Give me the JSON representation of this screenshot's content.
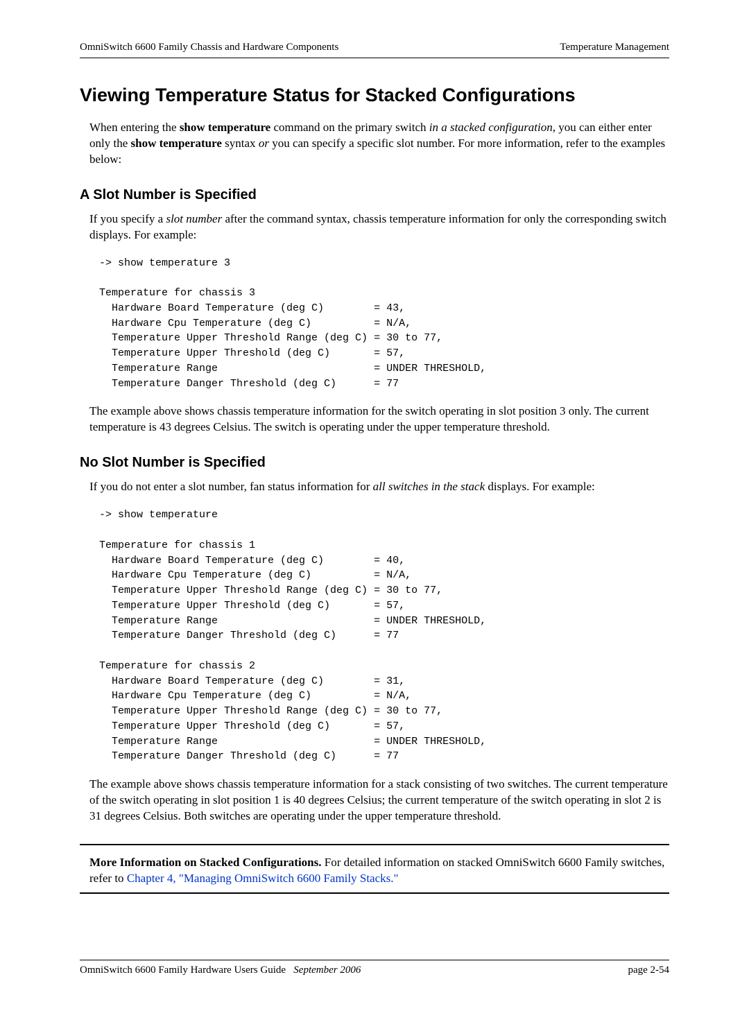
{
  "header": {
    "left": "OmniSwitch 6600 Family Chassis and Hardware Components",
    "right": "Temperature Management"
  },
  "h1": "Viewing Temperature Status for Stacked Configurations",
  "intro": {
    "part1": "When entering the ",
    "cmd": "show temperature",
    "part2": " command on the primary switch ",
    "italic1": "in a stacked configuration",
    "part3": ", you can either enter only the ",
    "cmd2": "show temperature",
    "part4": " syntax ",
    "italic2": "or",
    "part5": " you can specify a specific slot number. For more information, refer to the examples below:"
  },
  "section1": {
    "heading": "A Slot Number is Specified",
    "para_part1": "If you specify a ",
    "para_italic": "slot number",
    "para_part2": " after the command syntax, chassis temperature information for only the corresponding switch displays. For example:",
    "code": "-> show temperature 3\n\nTemperature for chassis 3\n  Hardware Board Temperature (deg C)        = 43,\n  Hardware Cpu Temperature (deg C)          = N/A,\n  Temperature Upper Threshold Range (deg C) = 30 to 77,\n  Temperature Upper Threshold (deg C)       = 57,\n  Temperature Range                         = UNDER THRESHOLD,\n  Temperature Danger Threshold (deg C)      = 77",
    "after": "The example above shows chassis temperature information for the switch operating in slot position 3 only. The current temperature is 43 degrees Celsius. The switch is operating under the upper temperature threshold."
  },
  "section2": {
    "heading": "No Slot Number is Specified",
    "para_part1": "If you do not enter a slot number, fan status information for ",
    "para_italic": "all switches in the stack",
    "para_part2": " displays. For example:",
    "code": "-> show temperature\n\nTemperature for chassis 1\n  Hardware Board Temperature (deg C)        = 40,\n  Hardware Cpu Temperature (deg C)          = N/A,\n  Temperature Upper Threshold Range (deg C) = 30 to 77,\n  Temperature Upper Threshold (deg C)       = 57,\n  Temperature Range                         = UNDER THRESHOLD,\n  Temperature Danger Threshold (deg C)      = 77\n\nTemperature for chassis 2\n  Hardware Board Temperature (deg C)        = 31,\n  Hardware Cpu Temperature (deg C)          = N/A,\n  Temperature Upper Threshold Range (deg C) = 30 to 77,\n  Temperature Upper Threshold (deg C)       = 57,\n  Temperature Range                         = UNDER THRESHOLD,\n  Temperature Danger Threshold (deg C)      = 77",
    "after": "The example above shows chassis temperature information for a stack consisting of two switches. The current temperature of the switch operating in slot position 1 is 40 degrees Celsius; the current temperature of the switch operating in slot 2 is 31 degrees Celsius. Both switches are operating under the upper temperature threshold."
  },
  "note": {
    "bold": "More Information on Stacked Configurations.",
    "text": " For detailed information on stacked OmniSwitch 6600 Family switches, refer to ",
    "link": "Chapter 4, \"Managing OmniSwitch 6600 Family Stacks.\""
  },
  "footer": {
    "left_plain": "OmniSwitch 6600 Family Hardware Users Guide",
    "left_italic": "September 2006",
    "right": "page 2-54"
  }
}
